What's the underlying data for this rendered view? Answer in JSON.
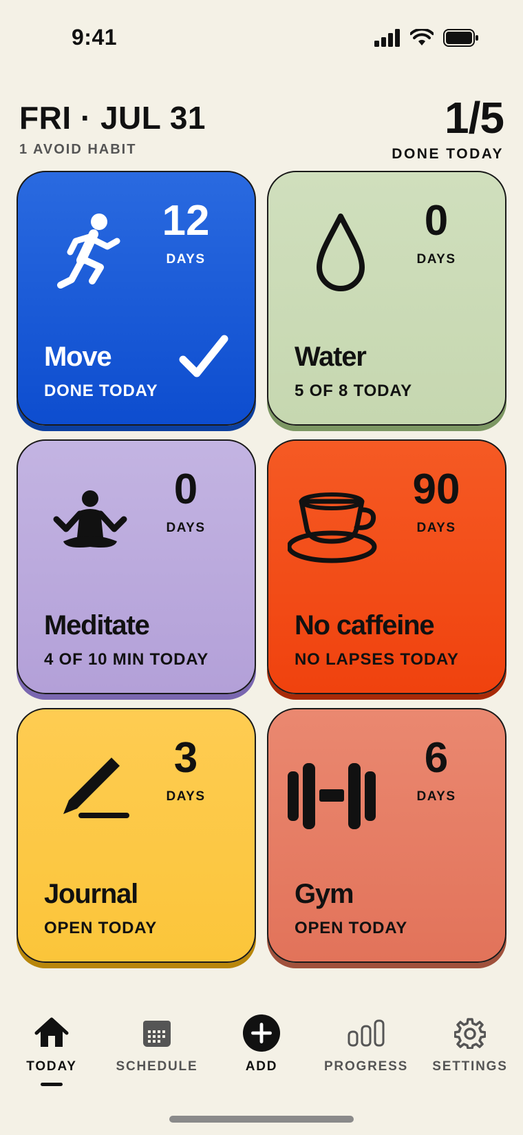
{
  "status_bar": {
    "time": "9:41"
  },
  "header": {
    "date": "FRI · JUL 31",
    "subtitle": "1 AVOID HABIT",
    "progress": "1/5",
    "progress_label": "DONE TODAY"
  },
  "habits": [
    {
      "name": "Move",
      "count": "12",
      "unit": "DAYS",
      "status": "DONE TODAY",
      "icon": "running-person-icon",
      "color": "#1a56db",
      "done": true
    },
    {
      "name": "Water",
      "count": "0",
      "unit": "DAYS",
      "status": "5 OF 8 TODAY",
      "icon": "water-drop-icon",
      "color": "#cddcb9"
    },
    {
      "name": "Meditate",
      "count": "0",
      "unit": "DAYS",
      "status": "4 OF 10 MIN TODAY",
      "icon": "meditation-icon",
      "color": "#b9a8dc"
    },
    {
      "name": "No caffeine",
      "count": "90",
      "unit": "DAYS",
      "status": "NO LAPSES TODAY",
      "icon": "coffee-cup-icon",
      "color": "#f24d19"
    },
    {
      "name": "Journal",
      "count": "3",
      "unit": "DAYS",
      "status": "OPEN TODAY",
      "icon": "pencil-icon",
      "color": "#fdc943"
    },
    {
      "name": "Gym",
      "count": "6",
      "unit": "DAYS",
      "status": "OPEN TODAY",
      "icon": "dumbbell-icon",
      "color": "#e77d62"
    }
  ],
  "tabs": [
    {
      "label": "TODAY",
      "icon": "home-icon",
      "active": true
    },
    {
      "label": "SCHEDULE",
      "icon": "calendar-icon"
    },
    {
      "label": "ADD",
      "icon": "plus-circle-icon"
    },
    {
      "label": "PROGRESS",
      "icon": "bar-chart-icon"
    },
    {
      "label": "SETTINGS",
      "icon": "gear-icon"
    }
  ]
}
